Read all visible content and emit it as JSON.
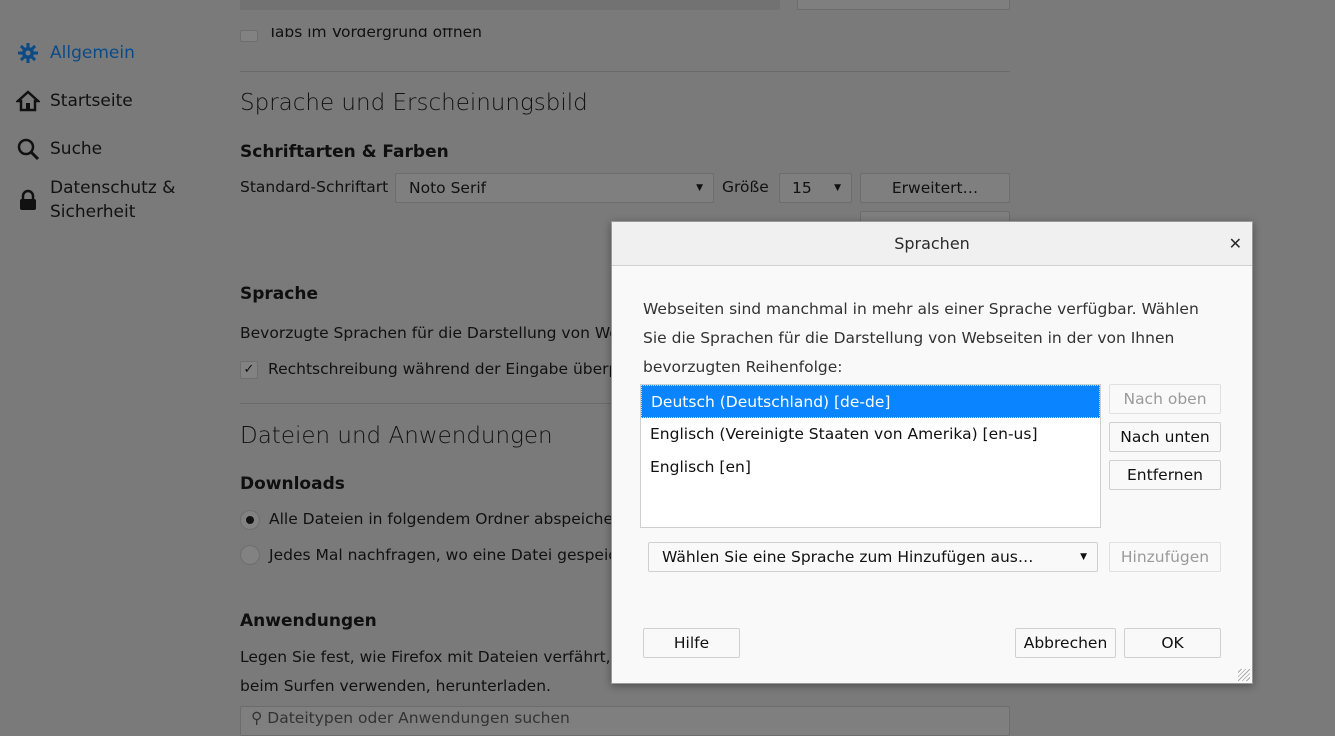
{
  "sidebar": {
    "items": [
      {
        "label": "Allgemein",
        "icon": "gear-icon",
        "active": true
      },
      {
        "label": "Startseite",
        "icon": "home-icon"
      },
      {
        "label": "Suche",
        "icon": "search-icon"
      },
      {
        "label": "Datenschutz &",
        "label2": "Sicherheit",
        "icon": "lock-icon"
      }
    ]
  },
  "main": {
    "tabs_checkbox": "Tabs im Vordergrund öffnen",
    "lang_section": "Sprache und Erscheinungsbild",
    "fonts_heading": "Schriftarten & Farben",
    "default_font_label": "Standard-Schriftart",
    "default_font_value": "Noto Serif",
    "size_label": "Größe",
    "size_value": "15",
    "advanced_button": "Erweitert…",
    "language_heading": "Sprache",
    "language_desc": "Bevorzugte Sprachen für die Darstellung von Webseiten wählen",
    "spellcheck": "Rechtschreibung während der Eingabe überprüfen",
    "files_section": "Dateien und Anwendungen",
    "downloads_heading": "Downloads",
    "radio_save": "Alle Dateien in folgendem Ordner abspeichern",
    "radio_ask": "Jedes Mal nachfragen, wo eine Datei gespeichert werden soll",
    "apps_heading": "Anwendungen",
    "apps_desc1": "Legen Sie fest, wie Firefox mit Dateien verfährt, die Sie",
    "apps_desc2": "beim Surfen verwenden, herunterladen.",
    "apps_search_placeholder": "Dateitypen oder Anwendungen suchen"
  },
  "dialog": {
    "title": "Sprachen",
    "description": "Webseiten sind manchmal in mehr als einer Sprache verfügbar. Wählen Sie die Sprachen für die Darstellung von Webseiten in der von Ihnen bevorzugten Reihenfolge:",
    "languages": [
      {
        "label": "Deutsch (Deutschland)  [de-de]",
        "selected": true
      },
      {
        "label": "Englisch (Vereinigte Staaten von Amerika)  [en-us]"
      },
      {
        "label": "Englisch  [en]"
      }
    ],
    "move_up": "Nach oben",
    "move_down": "Nach unten",
    "remove": "Entfernen",
    "add_select": "Wählen Sie eine Sprache zum Hinzufügen aus…",
    "add": "Hinzufügen",
    "help": "Hilfe",
    "cancel": "Abbrechen",
    "ok": "OK",
    "accent": "#0a84ff"
  }
}
